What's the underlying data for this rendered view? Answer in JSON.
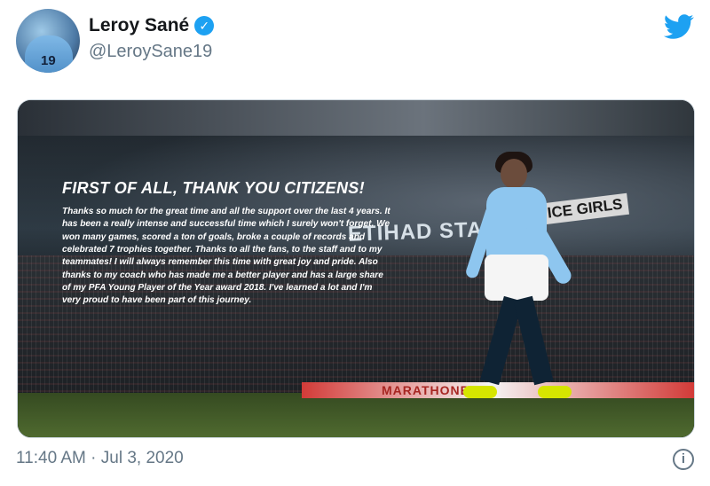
{
  "tweet": {
    "author": {
      "name": "Leroy Sané",
      "handle": "@LeroySane19",
      "avatar_number": "19"
    },
    "timestamp": "11:40 AM · Jul 3, 2020",
    "media": {
      "headline": "FIRST OF ALL, THANK YOU CITIZENS!",
      "message": "Thanks so much for the great time and all the support over the last 4 years. It has been a really intense and successful time which I surely won't forget. We won many games, scored a ton of goals, broke a couple of records and celebrated 7 trophies together. Thanks to all the fans, to the staff and to my teammates! I will always remember this time with great joy and pride. Also thanks to my coach who has made me a better player and has a large share of my PFA Young Player of the Year award 2018. I've learned a lot and I'm very proud to have been part of this journey.",
      "stadium_sign": "ETIHAD STADIUM",
      "sponsor_sign": "SPICE GIRLS",
      "board_text": "MARATHONBET"
    }
  },
  "colors": {
    "twitter_blue": "#1da1f2",
    "text_primary": "#14171a",
    "text_secondary": "#657786"
  },
  "icons": {
    "verified": "verified-badge-icon",
    "brand": "twitter-bird-icon",
    "info": "info-icon"
  }
}
